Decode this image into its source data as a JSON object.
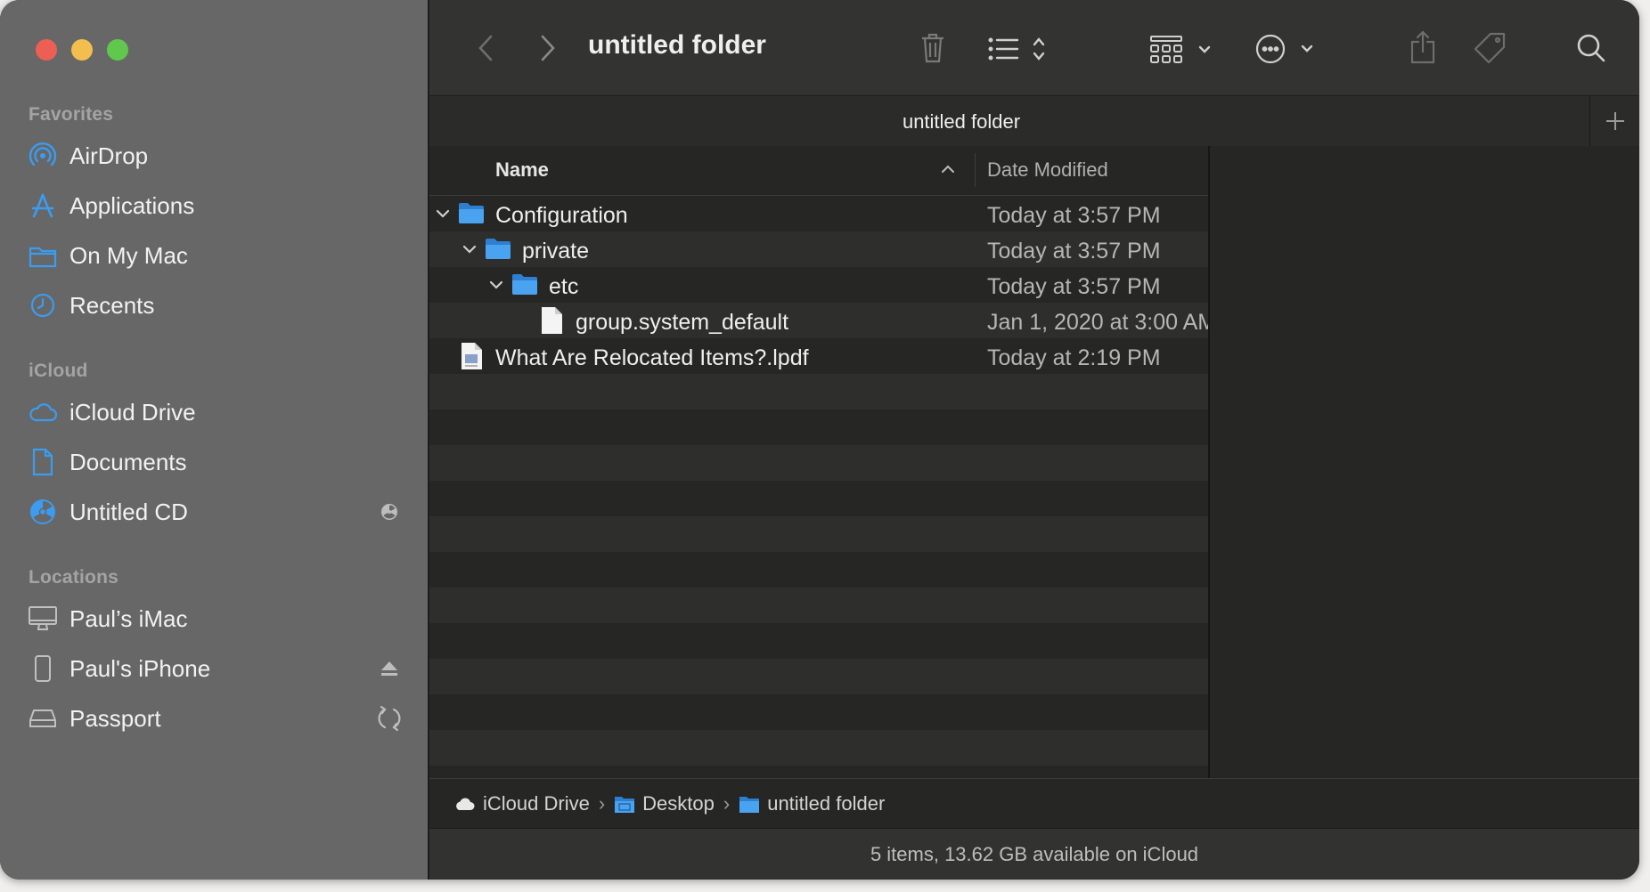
{
  "window": {
    "title": "untitled folder"
  },
  "colors": {
    "close": "#ed5f55",
    "minimize": "#f4be4f",
    "maximize": "#5fc84d",
    "accent_blue": "#3b9cf0",
    "folder_blue": "#4aa3f0"
  },
  "sidebar": {
    "favorites_label": "Favorites",
    "favorites": [
      {
        "label": "AirDrop",
        "icon": "airdrop-icon"
      },
      {
        "label": "Applications",
        "icon": "applications-icon"
      },
      {
        "label": "On My Mac",
        "icon": "folder-icon"
      },
      {
        "label": "Recents",
        "icon": "clock-icon"
      }
    ],
    "icloud_label": "iCloud",
    "icloud": [
      {
        "label": "iCloud Drive",
        "icon": "cloud-icon"
      },
      {
        "label": "Documents",
        "icon": "document-icon"
      },
      {
        "label": "Untitled CD",
        "icon": "cd-icon",
        "right_icon": "cd-badge-icon"
      }
    ],
    "locations_label": "Locations",
    "locations": [
      {
        "label": "Paul’s iMac",
        "icon": "imac-icon"
      },
      {
        "label": "Paul's iPhone",
        "icon": "iphone-icon",
        "right_icon": "eject-icon"
      },
      {
        "label": "Passport",
        "icon": "drive-icon",
        "right_icon": "sync-icon"
      }
    ]
  },
  "toolbar": {
    "title": "untitled folder",
    "icons": [
      "back-icon",
      "forward-icon",
      "trash-icon",
      "list-view-icon",
      "group-icon",
      "more-icon",
      "share-icon",
      "tag-icon",
      "search-icon"
    ]
  },
  "tabbar": {
    "title": "untitled folder",
    "add_label": "+"
  },
  "list": {
    "columns": {
      "name": "Name",
      "date": "Date Modified"
    },
    "rows": [
      {
        "name": "Configuration",
        "date": "Today at 3:57 PM",
        "kind": "folder",
        "level": 0,
        "expanded": true
      },
      {
        "name": "private",
        "date": "Today at 3:57 PM",
        "kind": "folder",
        "level": 1,
        "expanded": true
      },
      {
        "name": "etc",
        "date": "Today at 3:57 PM",
        "kind": "folder",
        "level": 2,
        "expanded": true
      },
      {
        "name": "group.system_default",
        "date": "Jan 1, 2020 at 3:00 AM",
        "kind": "file",
        "level": 3,
        "expanded": false
      },
      {
        "name": "What Are Relocated Items?.lpdf",
        "date": "Today at 2:19 PM",
        "kind": "pdf",
        "level": 0,
        "expanded": false
      }
    ]
  },
  "pathbar": {
    "crumbs": [
      {
        "label": "iCloud Drive",
        "icon": "cloud-icon"
      },
      {
        "label": "Desktop",
        "icon": "desktop-folder-icon"
      },
      {
        "label": "untitled folder",
        "icon": "folder-icon"
      }
    ],
    "separator": "›"
  },
  "status": {
    "text": "5 items, 13.62 GB available on iCloud"
  }
}
